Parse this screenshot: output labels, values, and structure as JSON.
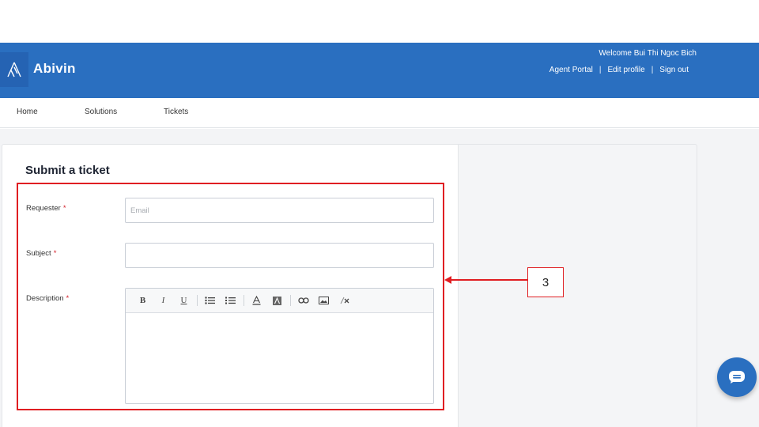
{
  "header": {
    "brand": "Abivin",
    "welcome": "Welcome Bui Thi Ngoc Bich",
    "links": {
      "agent_portal": "Agent Portal",
      "edit_profile": "Edit profile",
      "sign_out": "Sign out",
      "separator": "|"
    },
    "bg_color": "#2a6fc0"
  },
  "nav": {
    "home": "Home",
    "solutions": "Solutions",
    "tickets": "Tickets"
  },
  "form": {
    "title": "Submit a ticket",
    "requester_label": "Requester",
    "requester_placeholder": "Email",
    "subject_label": "Subject",
    "description_label": "Description",
    "required_mark": "*",
    "toolbar": {
      "bold": "B",
      "italic": "I",
      "underline": "U",
      "icons": [
        "bold-icon",
        "italic-icon",
        "underline-icon",
        "bullet-list-icon",
        "numbered-list-icon",
        "font-color-icon",
        "background-color-icon",
        "link-icon",
        "image-icon",
        "clear-format-icon"
      ]
    }
  },
  "annotation": {
    "callout_number": "3",
    "color": "#e01e22"
  },
  "chat": {
    "icon": "chat-icon"
  }
}
